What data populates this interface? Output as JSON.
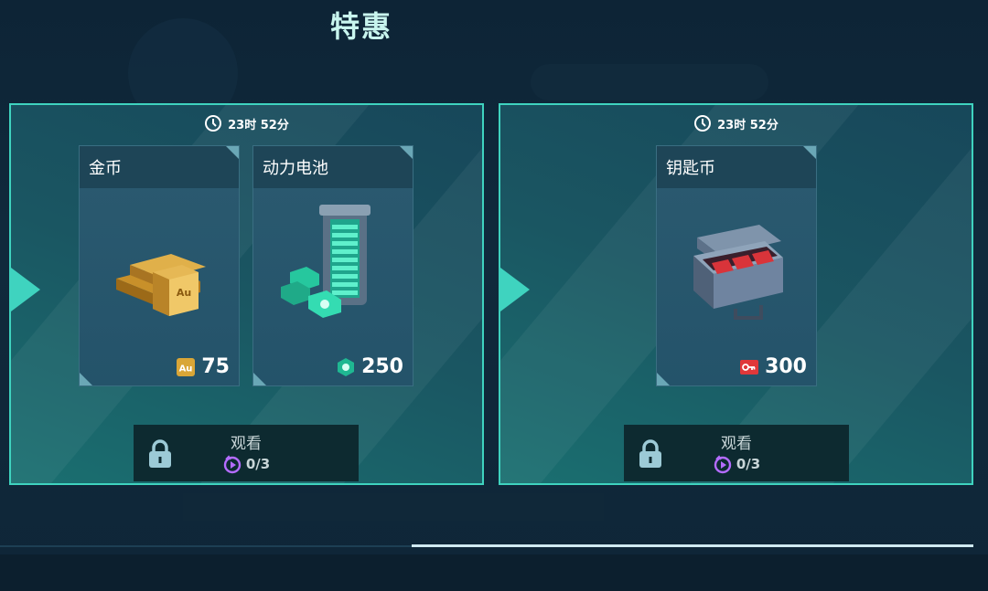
{
  "title": "特惠",
  "offers": [
    {
      "timer": "23时 52分",
      "items": [
        {
          "name": "金币",
          "amount": "75",
          "icon": "gold-au-icon"
        },
        {
          "name": "动力电池",
          "amount": "250",
          "icon": "power-cell-icon"
        }
      ],
      "watch": {
        "label": "观看",
        "count": "0/3"
      }
    },
    {
      "timer": "23时 52分",
      "items": [
        {
          "name": "钥匙币",
          "amount": "300",
          "icon": "key-coin-icon"
        }
      ],
      "watch": {
        "label": "观看",
        "count": "0/3"
      }
    }
  ],
  "colors": {
    "accent": "#3fd3bf",
    "video": "#b46cff",
    "key": "#e0383a",
    "gold": "#d9a637"
  }
}
